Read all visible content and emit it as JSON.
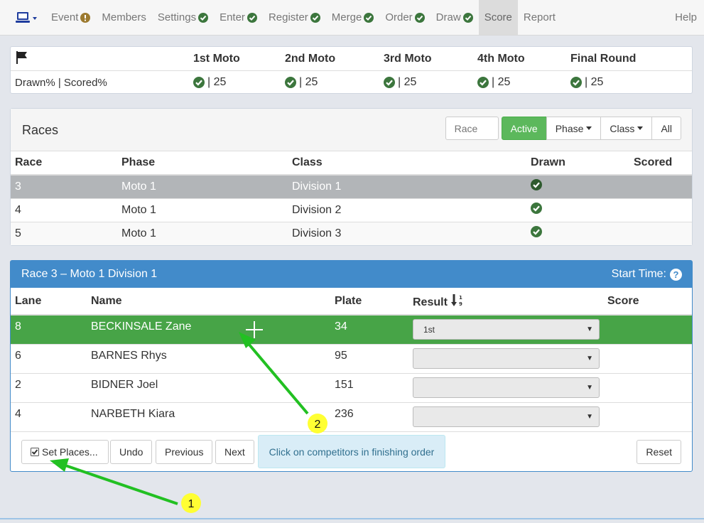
{
  "nav": {
    "items": [
      {
        "label": "Event",
        "badge": "warning"
      },
      {
        "label": "Members",
        "badge": ""
      },
      {
        "label": "Settings",
        "badge": "check"
      },
      {
        "label": "Enter",
        "badge": "check"
      },
      {
        "label": "Register",
        "badge": "check"
      },
      {
        "label": "Merge",
        "badge": "check"
      },
      {
        "label": "Order",
        "badge": "check"
      },
      {
        "label": "Draw",
        "badge": "check"
      },
      {
        "label": "Score",
        "badge": "",
        "active": true
      },
      {
        "label": "Report",
        "badge": ""
      }
    ],
    "help": "Help"
  },
  "progress": {
    "columns": [
      "1st Moto",
      "2nd Moto",
      "3rd Moto",
      "4th Moto",
      "Final Round"
    ],
    "row_label": "Drawn% | Scored%",
    "values": [
      "| 25",
      "| 25",
      "| 25",
      "| 25",
      "| 25"
    ]
  },
  "races": {
    "title": "Races",
    "search_placeholder": "Race",
    "buttons": {
      "active": "Active",
      "phase": "Phase",
      "class": "Class",
      "all": "All"
    },
    "columns": {
      "race": "Race",
      "phase": "Phase",
      "class": "Class",
      "drawn": "Drawn",
      "scored": "Scored"
    },
    "rows": [
      {
        "race": "3",
        "phase": "Moto 1",
        "class": "Division 1"
      },
      {
        "race": "4",
        "phase": "Moto 1",
        "class": "Division 2"
      },
      {
        "race": "5",
        "phase": "Moto 1",
        "class": "Division 3"
      }
    ]
  },
  "detail": {
    "title": "Race 3 – Moto 1 Division 1",
    "start_time": "Start Time:",
    "columns": {
      "lane": "Lane",
      "name": "Name",
      "plate": "Plate",
      "result": "Result",
      "score": "Score"
    },
    "rows": [
      {
        "lane": "8",
        "name": "BECKINSALE Zane",
        "plate": "34",
        "result": "1st"
      },
      {
        "lane": "6",
        "name": "BARNES Rhys",
        "plate": "95",
        "result": ""
      },
      {
        "lane": "2",
        "name": "BIDNER Joel",
        "plate": "151",
        "result": ""
      },
      {
        "lane": "4",
        "name": "NARBETH Kiara",
        "plate": "236",
        "result": ""
      }
    ],
    "footer": {
      "set_places": "Set Places...",
      "undo": "Undo",
      "previous": "Previous",
      "next": "Next",
      "info": "Click on competitors in finishing order",
      "reset": "Reset"
    }
  },
  "annotations": {
    "marker1": "1",
    "marker2": "2"
  },
  "colors": {
    "success": "#5cb85c",
    "primary": "#428bca",
    "check": "#3c763d",
    "arrow": "#22c022",
    "marker": "#ffff33"
  }
}
